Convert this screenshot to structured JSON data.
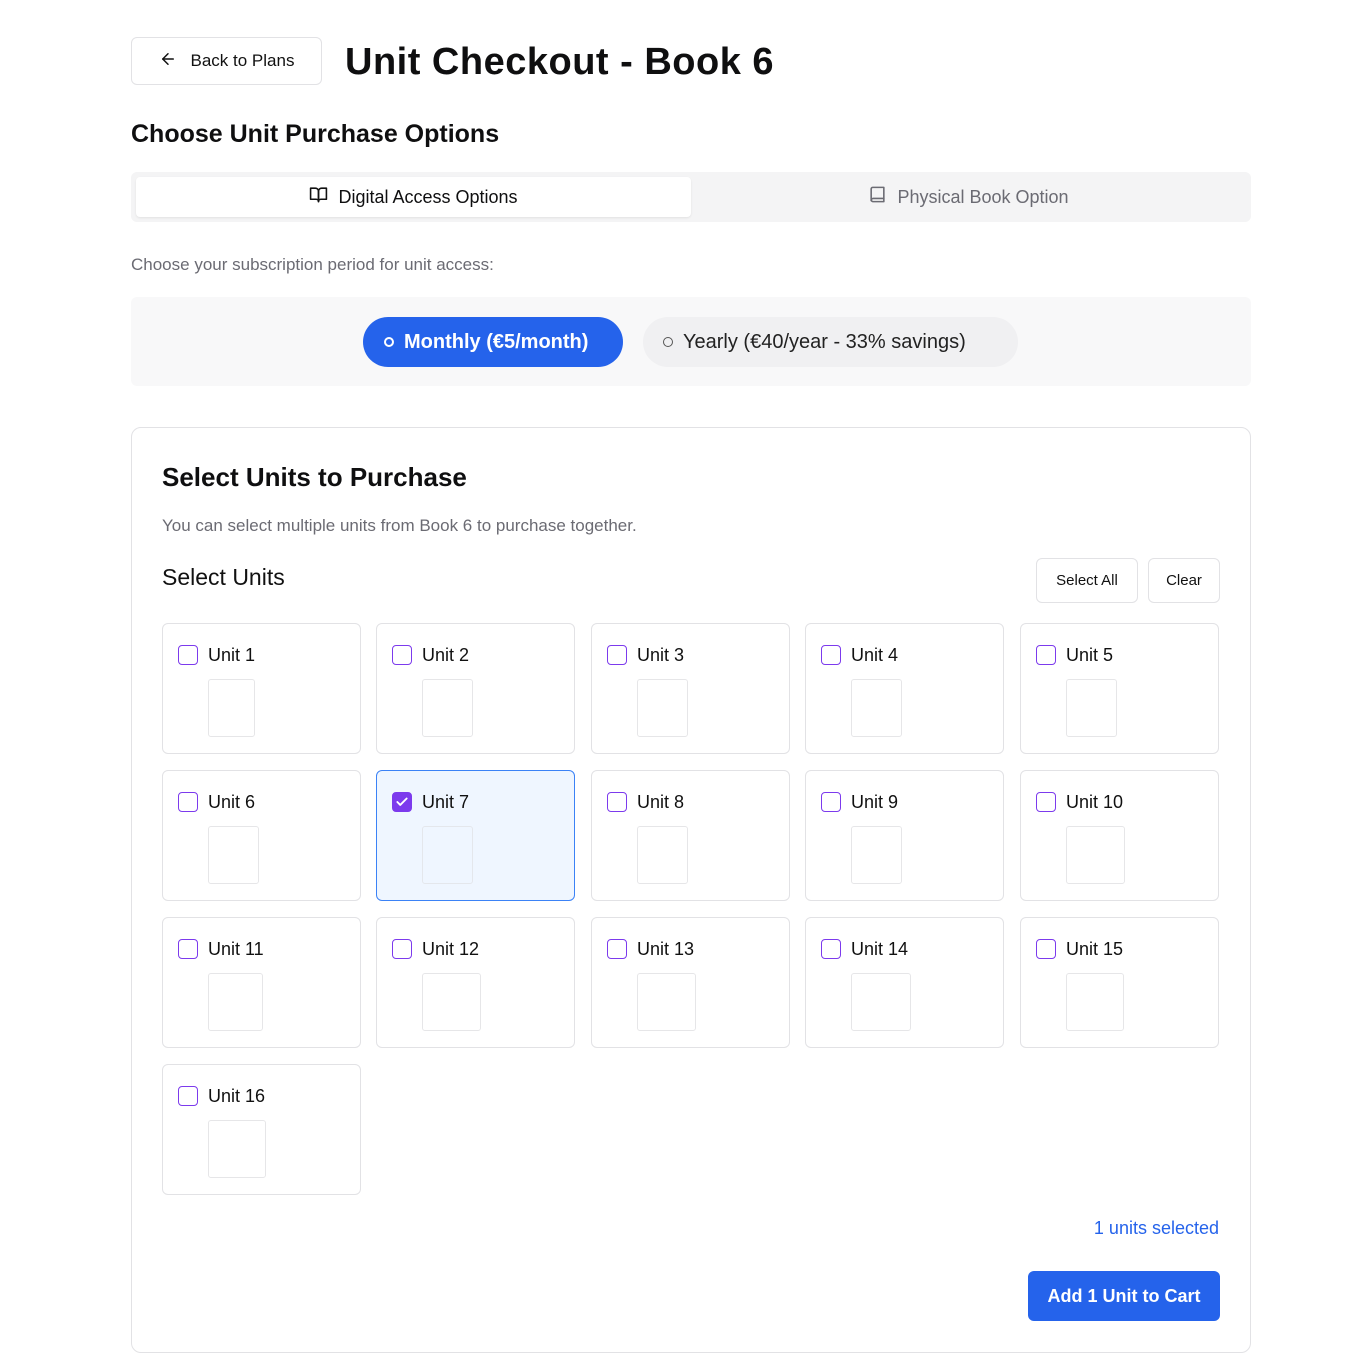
{
  "header": {
    "back_label": "Back to Plans",
    "title": "Unit Checkout - Book 6"
  },
  "options": {
    "title": "Choose Unit Purchase Options",
    "tabs": [
      {
        "label": "Digital Access Options",
        "icon": "book-open-icon",
        "active": true
      },
      {
        "label": "Physical Book Option",
        "icon": "book-icon",
        "active": false
      }
    ],
    "subscription_prompt": "Choose your subscription period for unit access:",
    "periods": [
      {
        "label": "Monthly (€5/month)",
        "selected": true
      },
      {
        "label": "Yearly (€40/year - 33% savings)",
        "selected": false
      }
    ]
  },
  "units_card": {
    "title": "Select Units to Purchase",
    "description": "You can select multiple units from Book 6 to purchase together.",
    "heading": "Select Units",
    "select_all_label": "Select All",
    "clear_label": "Clear",
    "units": [
      {
        "label": "Unit 1",
        "checked": false
      },
      {
        "label": "Unit 2",
        "checked": false
      },
      {
        "label": "Unit 3",
        "checked": false
      },
      {
        "label": "Unit 4",
        "checked": false
      },
      {
        "label": "Unit 5",
        "checked": false
      },
      {
        "label": "Unit 6",
        "checked": false
      },
      {
        "label": "Unit 7",
        "checked": true
      },
      {
        "label": "Unit 8",
        "checked": false
      },
      {
        "label": "Unit 9",
        "checked": false
      },
      {
        "label": "Unit 10",
        "checked": false
      },
      {
        "label": "Unit 11",
        "checked": false
      },
      {
        "label": "Unit 12",
        "checked": false
      },
      {
        "label": "Unit 13",
        "checked": false
      },
      {
        "label": "Unit 14",
        "checked": false
      },
      {
        "label": "Unit 15",
        "checked": false
      },
      {
        "label": "Unit 16",
        "checked": false
      }
    ],
    "selected_count_text": "1 units selected",
    "add_button_label": "Add 1 Unit to Cart"
  },
  "colors": {
    "accent": "#2563eb",
    "checkbox": "#7c3aed",
    "selected_bg": "#eff6ff"
  }
}
